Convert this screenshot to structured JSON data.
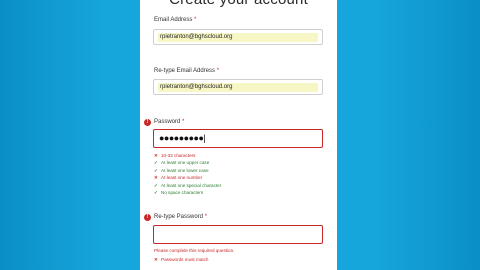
{
  "form": {
    "title": "Create your account",
    "email_label": "Email Address",
    "email_value": "rpietranton@bghscloud.org",
    "retype_email_label": "Re-type Email Address",
    "retype_email_value": "rpietranton@bghscloud.org",
    "password_label": "Password",
    "password_masked": "●●●●●●●●●|",
    "retype_password_label": "Re-type Password",
    "required_marker": "*",
    "error_badge": "!"
  },
  "password_rules": [
    {
      "text": "10-32 characters",
      "status": "fail",
      "mark": "✕"
    },
    {
      "text": "At least one upper case",
      "status": "pass",
      "mark": "✓"
    },
    {
      "text": "At least one lower case",
      "status": "pass",
      "mark": "✓"
    },
    {
      "text": "At least one number",
      "status": "fail",
      "mark": "✕"
    },
    {
      "text": "At least one special character",
      "status": "pass",
      "mark": "✓"
    },
    {
      "text": "No space characters",
      "status": "pass",
      "mark": "✓"
    }
  ],
  "retype_password_errors": {
    "required": "Please complete this required question.",
    "mismatch": "Passwords must match",
    "mismatch_mark": "✕"
  },
  "colors": {
    "background": "#16a6db",
    "error": "#c62828",
    "success": "#2e7d32",
    "autofill": "#f7f7c6"
  }
}
